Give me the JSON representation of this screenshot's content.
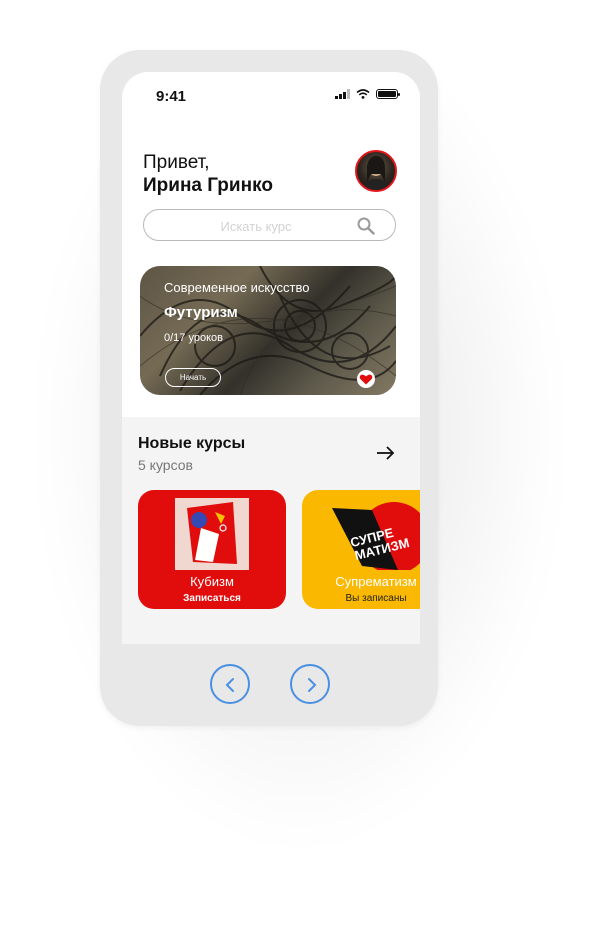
{
  "status_bar": {
    "time": "9:41"
  },
  "greeting": {
    "hello": "Привет,",
    "name": "Ирина Гринко"
  },
  "search": {
    "placeholder": "Искать курс"
  },
  "featured_course": {
    "category": "Современное искусство",
    "title": "Футуризм",
    "progress": "0/17 уроков",
    "start_label": "Начать",
    "favorite": true
  },
  "new_courses": {
    "title": "Новые курсы",
    "count": "5 курсов",
    "cards": [
      {
        "title": "Кубизм",
        "action": "Записаться",
        "color": "#e10c0c"
      },
      {
        "title": "Супрематизм",
        "action": "Вы записаны",
        "color": "#fbb800",
        "logo_text": "СУПРЕМАТИЗМ"
      }
    ]
  },
  "colors": {
    "accent_red": "#e10c0c",
    "accent_yellow": "#fbb800",
    "nav_blue": "#4a90e2"
  },
  "icons": [
    "search-icon",
    "arrow-right-icon",
    "heart-icon",
    "chevron-left-icon",
    "chevron-right-icon"
  ]
}
